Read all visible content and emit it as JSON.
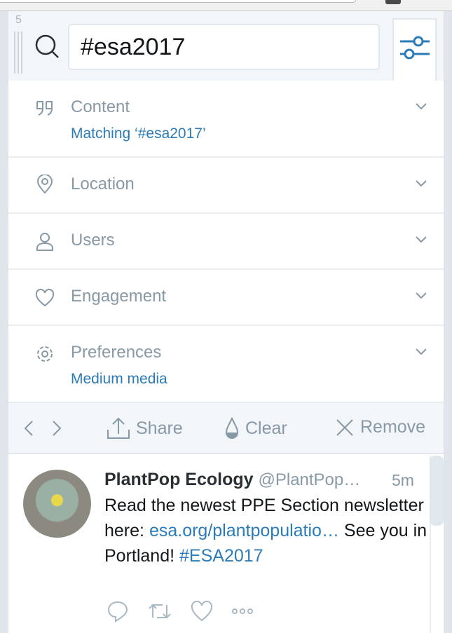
{
  "column": {
    "number": "5",
    "search_value": "#esa2017"
  },
  "filters": [
    {
      "label": "Content",
      "icon": "quote-icon",
      "summary": "Matching ‘#esa2017’"
    },
    {
      "label": "Location",
      "icon": "location-pin-icon"
    },
    {
      "label": "Users",
      "icon": "user-icon"
    },
    {
      "label": "Engagement",
      "icon": "heart-icon"
    },
    {
      "label": "Preferences",
      "icon": "gear-icon",
      "summary": "Medium media"
    }
  ],
  "toolbar": {
    "share": "Share",
    "clear": "Clear",
    "remove": "Remove"
  },
  "tweet": {
    "name": "PlantPop Ecology",
    "handle": "@PlantPop…",
    "time": "5m",
    "text_before": "Read the newest PPE Section newsletter here: ",
    "link": "esa.org/plantpopulatio…",
    "text_mid": " See you in Portland! ",
    "hashtag": "#ESA2017"
  },
  "colors": {
    "accent": "#2b7bb9",
    "muted": "#8899a6",
    "header_bg": "#f3f6f9"
  }
}
